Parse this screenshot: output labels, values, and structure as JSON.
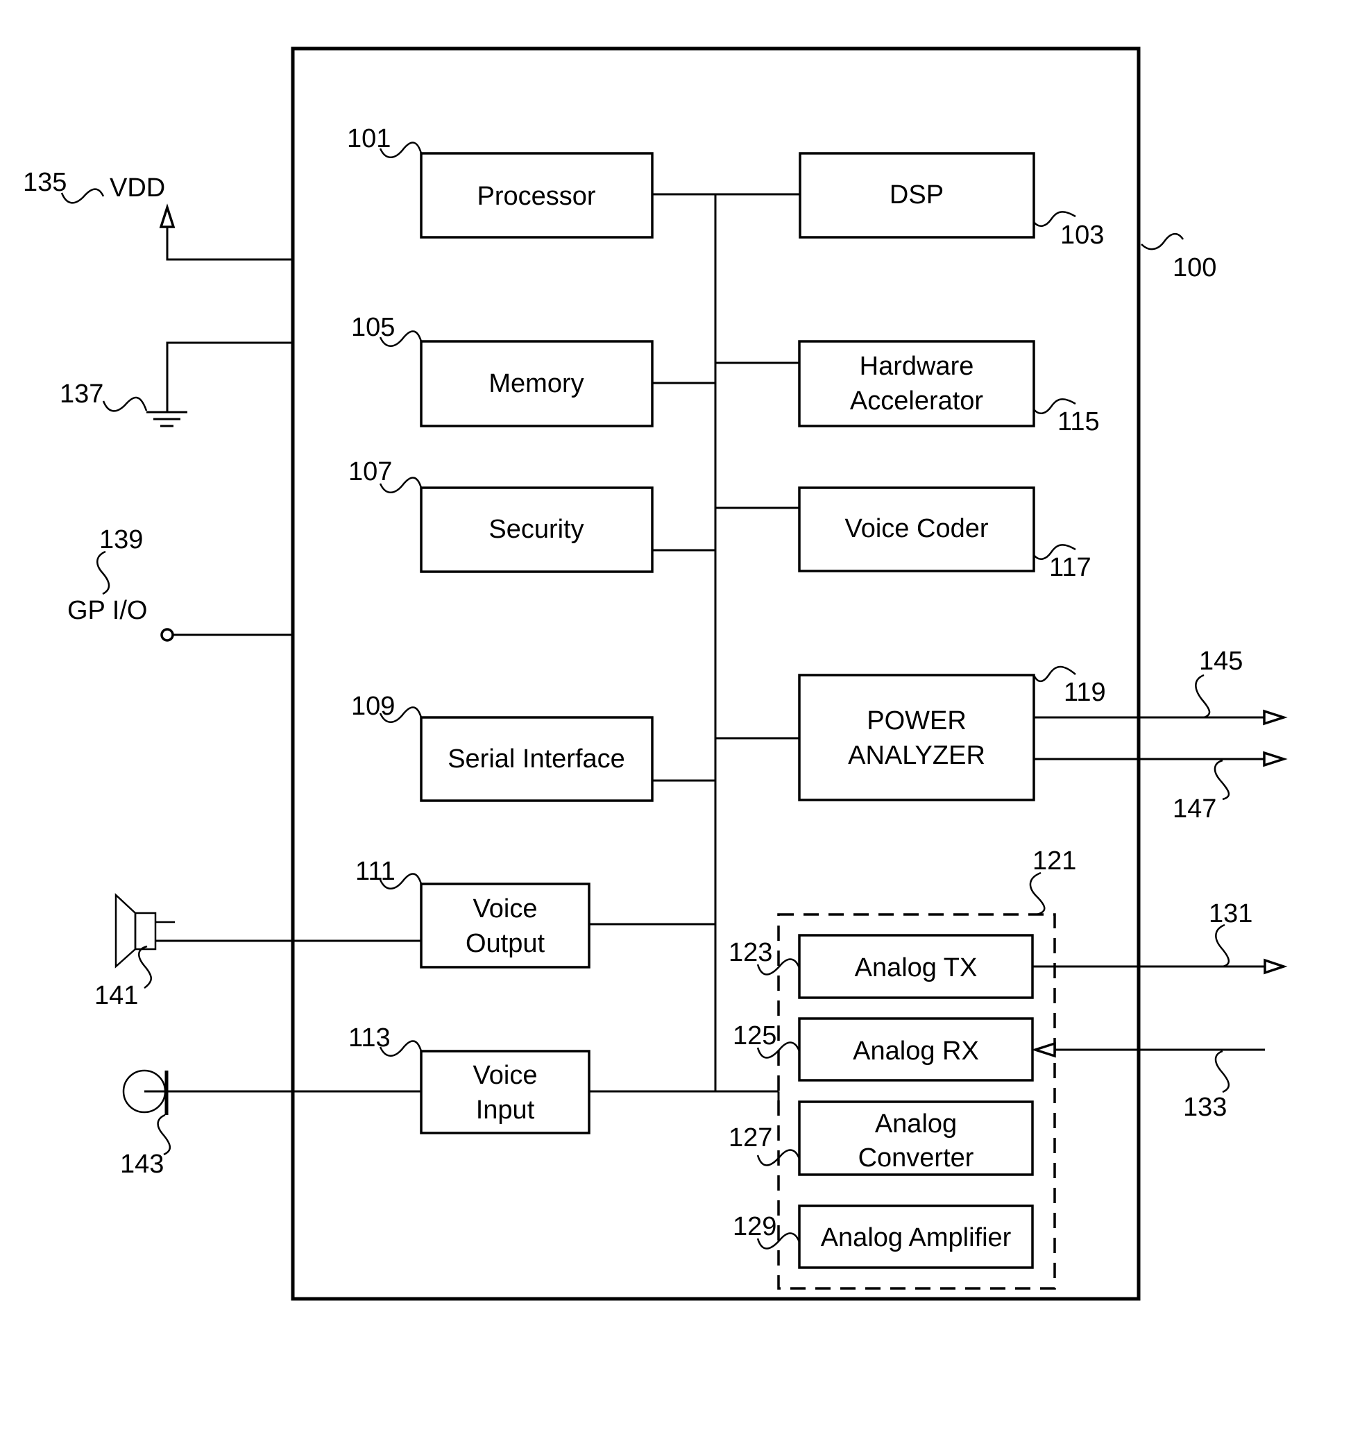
{
  "figure": {
    "system_ref": "100",
    "bus": {
      "label": ""
    }
  },
  "blocks": {
    "processor": {
      "ref": "101",
      "lines": [
        "Processor"
      ]
    },
    "dsp": {
      "ref": "103",
      "lines": [
        "DSP"
      ]
    },
    "memory": {
      "ref": "105",
      "lines": [
        "Memory"
      ]
    },
    "hardware_accelerator": {
      "ref": "115",
      "lines": [
        "Hardware",
        "Accelerator"
      ]
    },
    "security": {
      "ref": "107",
      "lines": [
        "Security"
      ]
    },
    "voice_coder": {
      "ref": "117",
      "lines": [
        "Voice Coder"
      ]
    },
    "serial_interface": {
      "ref": "109",
      "lines": [
        "Serial Interface"
      ]
    },
    "power_analyzer": {
      "ref": "119",
      "lines": [
        "POWER",
        "ANALYZER"
      ]
    },
    "voice_output": {
      "ref": "111",
      "lines": [
        "Voice",
        "Output"
      ]
    },
    "voice_input": {
      "ref": "113",
      "lines": [
        "Voice",
        "Input"
      ]
    },
    "analog_group": {
      "ref": "121"
    },
    "analog_tx": {
      "ref": "123",
      "lines": [
        "Analog TX"
      ]
    },
    "analog_rx": {
      "ref": "125",
      "lines": [
        "Analog RX"
      ]
    },
    "analog_converter": {
      "ref": "127",
      "lines": [
        "Analog",
        "Converter"
      ]
    },
    "analog_amplifier": {
      "ref": "129",
      "lines": [
        "Analog Amplifier"
      ]
    }
  },
  "external": {
    "vdd": {
      "ref": "135",
      "label": "VDD",
      "icon": "power-supply-arrow-icon"
    },
    "ground": {
      "ref": "137",
      "icon": "ground-icon"
    },
    "gpio": {
      "ref": "139",
      "label": "GP I/O",
      "icon": "terminal-circle-icon"
    },
    "speaker": {
      "ref": "141",
      "icon": "speaker-icon"
    },
    "microphone": {
      "ref": "143",
      "icon": "microphone-icon"
    },
    "power_out_1": {
      "ref": "145",
      "icon": "output-arrow-icon"
    },
    "power_out_2": {
      "ref": "147",
      "icon": "output-arrow-icon"
    },
    "analog_out": {
      "ref": "131",
      "icon": "output-arrow-icon"
    },
    "analog_in": {
      "ref": "133",
      "icon": "input-arrow-icon"
    }
  }
}
